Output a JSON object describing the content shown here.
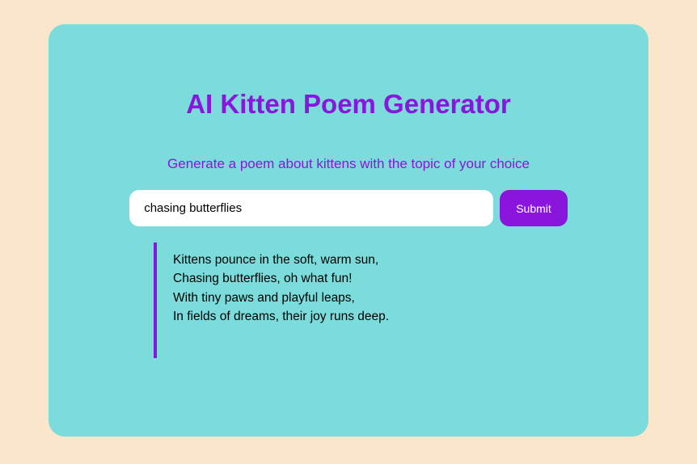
{
  "title": "AI Kitten Poem Generator",
  "subtitle": "Generate a poem about kittens with the topic of your choice",
  "input": {
    "value": "chasing butterflies"
  },
  "submit_label": "Submit",
  "poem": "Kittens pounce in the soft, warm sun,\nChasing butterflies, oh what fun!\nWith tiny paws and playful leaps,\nIn fields of dreams, their joy runs deep."
}
